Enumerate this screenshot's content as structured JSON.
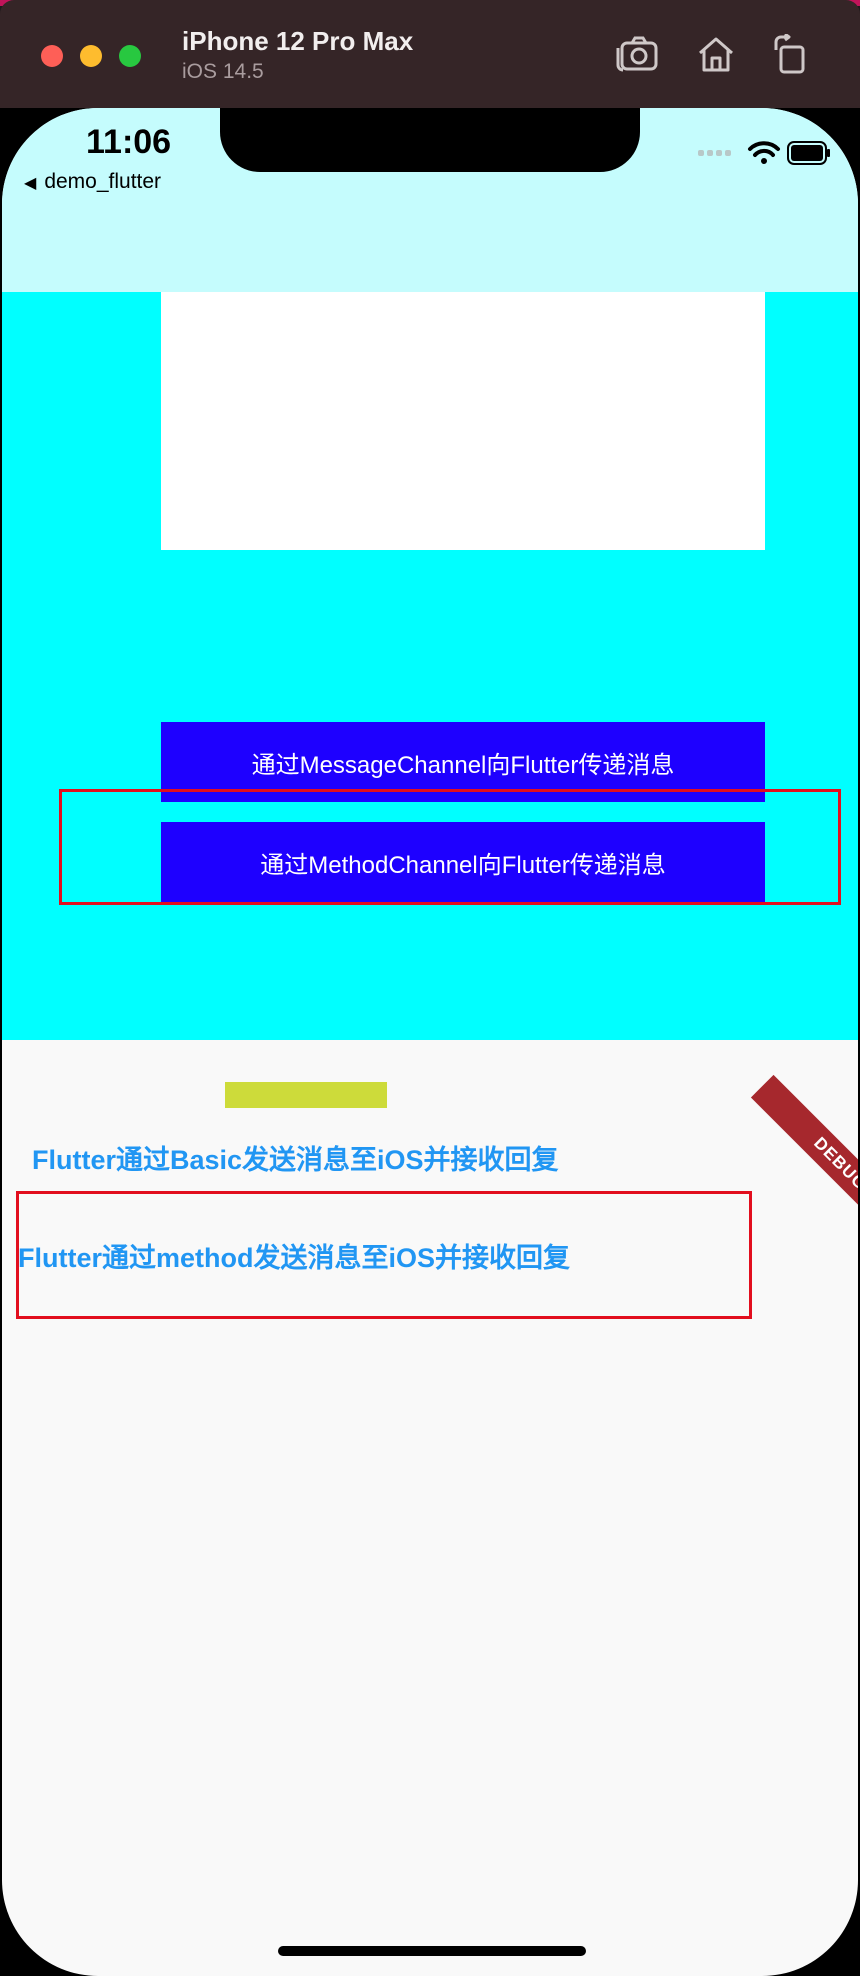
{
  "simulator": {
    "device_name": "iPhone 12 Pro Max",
    "os_version": "iOS 14.5",
    "icons": [
      "screenshot-icon",
      "home-icon",
      "rotate-icon"
    ],
    "accent_color": "#c0145a"
  },
  "status_bar": {
    "time": "11:06",
    "back_app": "demo_flutter",
    "icons": [
      "signal-icon",
      "wifi-icon",
      "battery-icon"
    ]
  },
  "native": {
    "background_color": "#00ffff",
    "message_channel_button": "通过MessageChannel向Flutter传递消息",
    "method_channel_button": "通过MethodChannel向Flutter传递消息",
    "button_color": "#1e00ff"
  },
  "flutter": {
    "debug_banner": "DEBUG",
    "basic_link": "Flutter通过Basic发送消息至iOS并接收回复",
    "method_link": "Flutter通过method发送消息至iOS并接收回复",
    "link_color": "#2196f3",
    "highlight_color": "#e20e1e"
  }
}
